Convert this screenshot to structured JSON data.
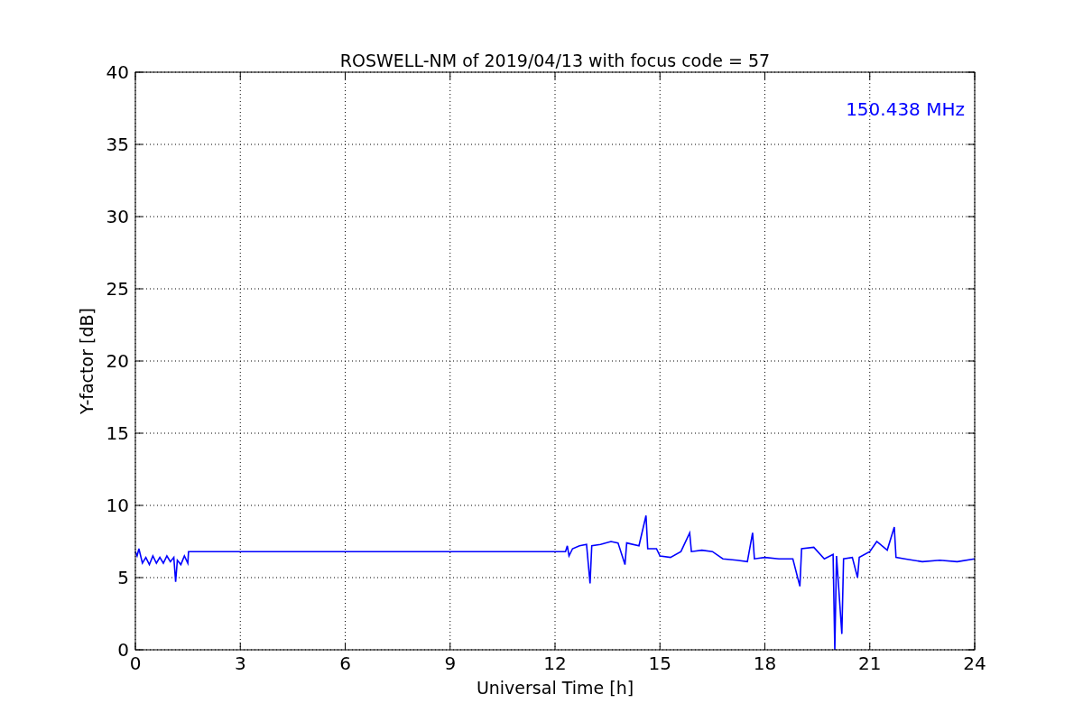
{
  "chart": {
    "chart_data": {
      "type": "line",
      "title": "ROSWELL-NM of 2019/04/13 with focus code = 57",
      "xlabel": "Universal Time [h]",
      "ylabel": "Y-factor [dB]",
      "x": [
        0,
        0.05,
        0.1,
        0.2,
        0.3,
        0.4,
        0.5,
        0.6,
        0.7,
        0.8,
        0.9,
        1.0,
        1.1,
        1.15,
        1.2,
        1.3,
        1.4,
        1.5,
        1.52,
        12.3,
        12.35,
        12.4,
        12.5,
        12.7,
        12.9,
        13.0,
        13.05,
        13.3,
        13.6,
        13.8,
        14.0,
        14.05,
        14.4,
        14.6,
        14.65,
        14.9,
        15.0,
        15.3,
        15.6,
        15.85,
        15.9,
        16.2,
        16.5,
        16.8,
        17.2,
        17.5,
        17.65,
        17.7,
        18.0,
        18.4,
        18.8,
        19.0,
        19.05,
        19.4,
        19.7,
        19.95,
        20.0,
        20.05,
        20.2,
        20.25,
        20.5,
        20.65,
        20.7,
        21.0,
        21.2,
        21.5,
        21.7,
        21.75,
        22.0,
        22.5,
        23.0,
        23.5,
        24.0
      ],
      "series": [
        {
          "name": "150.438 MHz",
          "color": "#0000ff",
          "values": [
            6.8,
            6.5,
            7.0,
            6.0,
            6.4,
            5.9,
            6.5,
            6.0,
            6.4,
            6.0,
            6.5,
            6.1,
            6.4,
            4.7,
            6.2,
            5.9,
            6.5,
            6.0,
            6.8,
            6.8,
            7.2,
            6.5,
            7.0,
            7.2,
            7.3,
            4.6,
            7.2,
            7.3,
            7.5,
            7.4,
            5.9,
            7.4,
            7.2,
            9.3,
            7.0,
            7.0,
            6.5,
            6.4,
            6.8,
            8.1,
            6.8,
            6.9,
            6.8,
            6.3,
            6.2,
            6.1,
            8.1,
            6.3,
            6.4,
            6.3,
            6.3,
            4.4,
            7.0,
            7.1,
            6.3,
            6.6,
            0,
            6.5,
            1.1,
            6.3,
            6.4,
            5.0,
            6.4,
            6.8,
            7.5,
            6.9,
            8.5,
            6.4,
            6.3,
            6.1,
            6.2,
            6.1,
            6.3
          ]
        }
      ],
      "xlim": [
        0,
        24
      ],
      "ylim": [
        0,
        40
      ],
      "xticks": [
        0,
        3,
        6,
        9,
        12,
        15,
        18,
        21,
        24
      ],
      "yticks": [
        0,
        5,
        10,
        15,
        20,
        25,
        30,
        35,
        40
      ],
      "grid": true
    }
  }
}
